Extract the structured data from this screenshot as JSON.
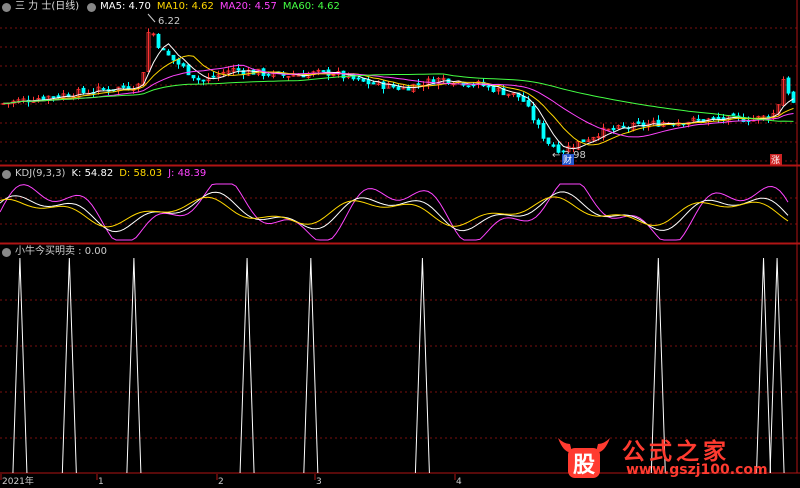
{
  "title": "三 力 士(日线)",
  "main_legend": [
    {
      "label": "MA5: 4.70",
      "color": "#ffffff"
    },
    {
      "label": "MA10: 4.62",
      "color": "#ffd700"
    },
    {
      "label": "MA20: 4.57",
      "color": "#ff44ff"
    },
    {
      "label": "MA60: 4.62",
      "color": "#44ff44"
    }
  ],
  "high_label": "6.22",
  "low_label": "3.98",
  "marker_cai": "财",
  "marker_zhang": "涨",
  "kdj_legend": [
    {
      "label": "KDJ(9,3,3)",
      "color": "#cccccc"
    },
    {
      "label": "K: 54.82",
      "color": "#ffffff"
    },
    {
      "label": "D: 58.03",
      "color": "#ffd700"
    },
    {
      "label": "J: 48.39",
      "color": "#ff44ff"
    }
  ],
  "signal_legend": [
    {
      "label": "小牛今买明卖 : 0.00",
      "color": "#cccccc"
    }
  ],
  "x_axis": [
    "2021年",
    "1",
    "2",
    "3",
    "4"
  ],
  "watermark": {
    "logo_char": "股",
    "title": "公式之家",
    "url": "www.gszj100.com"
  },
  "colors": {
    "up": "#ff3333",
    "down": "#00ffff",
    "grid": "#7a1010",
    "border": "#b01515"
  },
  "chart_data": {
    "type": "line",
    "price_range": [
      3.98,
      6.22
    ],
    "kdj_range": [
      0,
      100
    ],
    "signal_range": [
      0,
      1
    ],
    "signal_spikes_fraction": [
      0.025,
      0.087,
      0.168,
      0.31,
      0.39,
      0.53,
      0.826,
      0.958,
      0.975
    ]
  }
}
